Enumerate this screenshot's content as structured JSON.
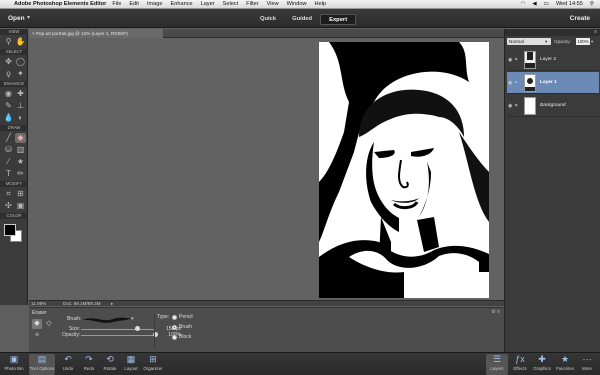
{
  "menubar": {
    "apple_icon": "apple-icon",
    "app_name": "Adobe Photoshop Elements Editor",
    "items": [
      "File",
      "Edit",
      "Image",
      "Enhance",
      "Layer",
      "Select",
      "Filter",
      "View",
      "Window",
      "Help"
    ],
    "clock": "Wed 14:55"
  },
  "topbar": {
    "open_label": "Open",
    "modes": [
      "Quick",
      "Guided",
      "Expert"
    ],
    "active_mode": "Expert",
    "create_label": "Create"
  },
  "toolbox": {
    "sections": [
      "VIEW",
      "SELECT",
      "ENHANCE",
      "DRAW",
      "MODIFY",
      "COLOR"
    ]
  },
  "document": {
    "tab_title": "Pop art portrait.jpg @ 12% (Layer 1, RGB/8*)",
    "zoom": "11.98%",
    "doc_size": "Doc: 69.1M/88.3M"
  },
  "tool_options": {
    "tool_name": "Eraser",
    "brush_label": "Brush:",
    "size_label": "Size:",
    "size_value": "150 px",
    "size_fraction": 0.74,
    "opacity_label": "Opacity:",
    "opacity_value": "100%",
    "opacity_fraction": 1.0,
    "type_label": "Type:",
    "types": [
      "Pencil",
      "Brush",
      "Block"
    ],
    "selected_type": "Brush"
  },
  "layers_panel": {
    "blend_mode": "Normal",
    "opacity_label": "Opacity:",
    "opacity_value": "100%",
    "layers": [
      {
        "name": "Layer 2",
        "selected": false
      },
      {
        "name": "Layer 1",
        "selected": true
      },
      {
        "name": "Background",
        "selected": false
      }
    ]
  },
  "dock": {
    "left": [
      "Photo Bin",
      "Tool Options",
      "Undo",
      "Redo",
      "Rotate",
      "Layout",
      "Organizer"
    ],
    "right": [
      "Layers",
      "Effects",
      "Graphics",
      "Favorites",
      "More"
    ],
    "active": [
      "Tool Options",
      "Layers"
    ]
  },
  "colors": {
    "accent_selected_layer": "#6b8ab5",
    "foreground": "#000000",
    "background": "#ffffff"
  }
}
